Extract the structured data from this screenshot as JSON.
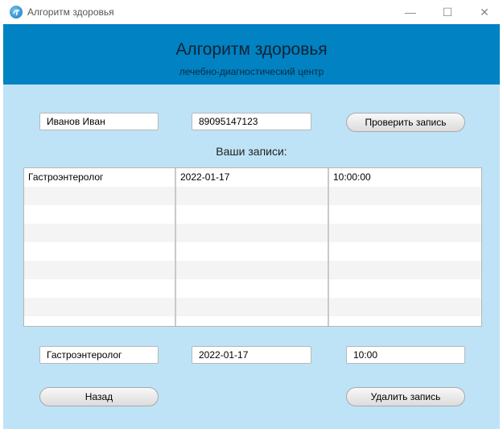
{
  "window": {
    "title": "Алгоритм здоровья",
    "min_glyph": "—",
    "max_glyph": "☐",
    "close_glyph": "✕"
  },
  "header": {
    "title": "Алгоритм здоровья",
    "subtitle": "лечебно-диагностический центр"
  },
  "search": {
    "name_value": "Иванов Иван",
    "phone_value": "89095147123",
    "check_button": "Проверить запись"
  },
  "records": {
    "label": "Ваши записи:",
    "rows": [
      {
        "doctor": "Гастроэнтеролог",
        "date": "2022-01-17",
        "time": "10:00:00"
      }
    ]
  },
  "selected": {
    "doctor_value": "Гастроэнтеролог",
    "date_value": "2022-01-17",
    "time_value": "10:00"
  },
  "actions": {
    "back_button": "Назад",
    "delete_button": "Удалить запись"
  },
  "colors": {
    "header_bg": "#0082c3",
    "content_bg": "#bee3f6"
  }
}
